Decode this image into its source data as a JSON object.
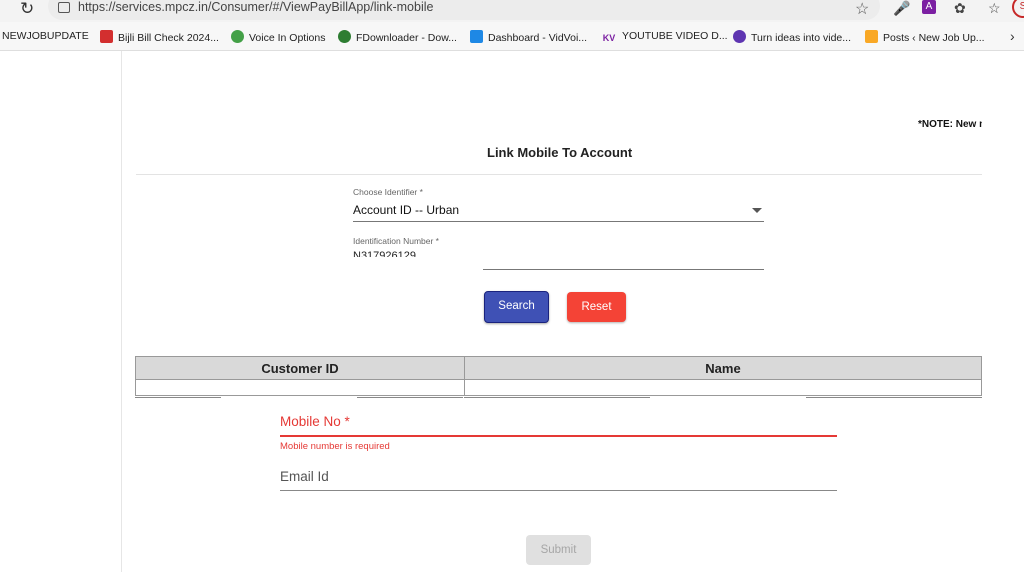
{
  "browser": {
    "url": "https://services.mpcz.in/Consumer/#/ViewPayBillApp/link-mobile",
    "bookmarks": [
      {
        "label": "NEWJOBUPDATE"
      },
      {
        "label": "Bijli Bill Check 2024..."
      },
      {
        "label": "Voice In Options"
      },
      {
        "label": "FDownloader - Dow..."
      },
      {
        "label": "Dashboard - VidVoi..."
      },
      {
        "label": "YOUTUBE VIDEO D..."
      },
      {
        "label": "Turn ideas into vide..."
      },
      {
        "label": "Posts ‹ New Job Up..."
      }
    ],
    "icon_text": {
      "kv": "KV",
      "profile": "S"
    }
  },
  "page": {
    "note": "*NOTE: New m",
    "title": "Link Mobile To Account",
    "identifier": {
      "label": "Choose Identifier *",
      "value": "Account ID -- Urban"
    },
    "id_number": {
      "label": "Identification Number *",
      "value": "N317926129"
    },
    "search_button": "Search",
    "reset_button": "Reset",
    "table": {
      "headers": [
        "Customer ID",
        "Name"
      ]
    },
    "mobile": {
      "label": "Mobile No *",
      "error": "Mobile number is required"
    },
    "email": {
      "label": "Email Id"
    },
    "submit_button": "Submit"
  },
  "colors": {
    "primary": "#3f51b5",
    "reset": "#f44336",
    "error": "#e53935",
    "disabled": "#e0e0e0"
  }
}
